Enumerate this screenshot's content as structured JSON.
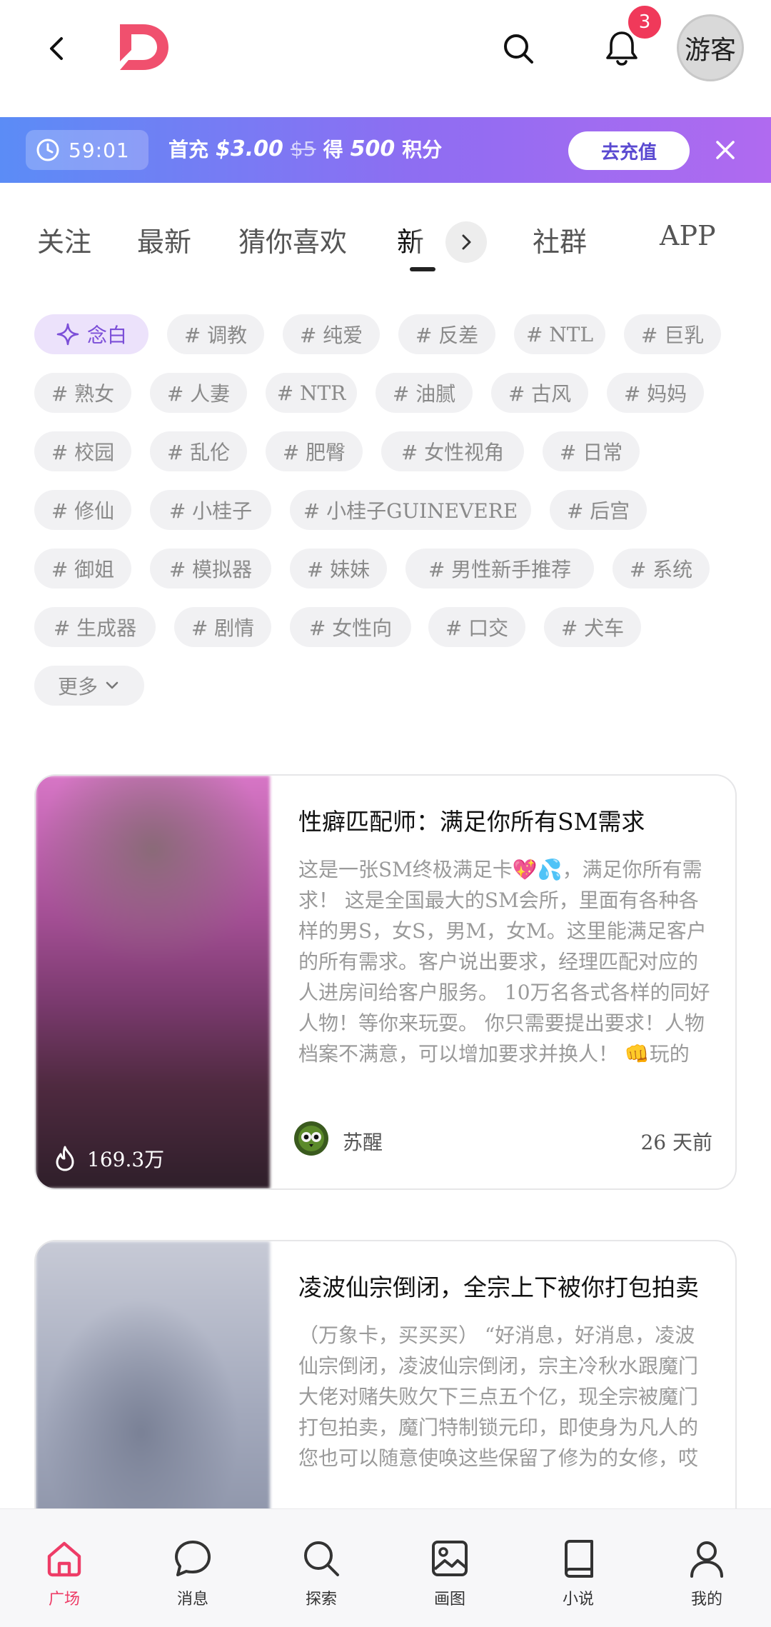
{
  "header": {
    "avatar_label": "游客",
    "notification_count": "3"
  },
  "promo": {
    "timer": "59:01",
    "text_prefix": "首充",
    "price": "$3.00",
    "original_price": "$5",
    "text_get": "得",
    "points": "500",
    "text_suffix": "积分",
    "cta": "去充值"
  },
  "tabs": [
    "关注",
    "最新",
    "猜你喜欢",
    "新",
    "社群",
    "APP"
  ],
  "tags": {
    "featured": "念白",
    "items": [
      "# 调教",
      "# 纯爱",
      "# 反差",
      "# NTL",
      "# 巨乳",
      "# 熟女",
      "# 人妻",
      "# NTR",
      "# 油腻",
      "# 古风",
      "# 妈妈",
      "# 校园",
      "# 乱伦",
      "# 肥臀",
      "# 女性视角",
      "# 日常",
      "# 修仙",
      "# 小桂子",
      "# 小桂子GUINEVERE",
      "# 后宫",
      "# 御姐",
      "# 模拟器",
      "# 妹妹",
      "# 男性新手推荐",
      "# 系统",
      "# 生成器",
      "# 剧情",
      "# 女性向",
      "# 口交",
      "# 犬车"
    ],
    "more": "更多"
  },
  "cards": [
    {
      "title": "性癖匹配师：满足你所有SM需求",
      "description": "这是一张SM终极满足卡💖💦，满足你所有需求！ 这是全国最大的SM会所，里面有各种各样的男S，女S，男M，女M。这里能满足客户的所有需求。客户说出要求，经理匹配对应的人进房间给客户服务。 10万名各式各样的同好人物！等你来玩耍。 你只需要提出要求！人物档案不满意，可以增加要求并换人！ 👊玩的",
      "views": "169.3万",
      "author": "苏醒",
      "time": "26 天前"
    },
    {
      "title": "凌波仙宗倒闭，全宗上下被你打包拍卖",
      "description": "（万象卡，买买买） “好消息，好消息，凌波仙宗倒闭，凌波仙宗倒闭，宗主冷秋水跟魔门大佬对赌失败欠下三点五个亿，现全宗被魔门打包拍卖，魔门特制锁元印，即使身为凡人的您也可以随意使唤这些保留了修为的女修，哎"
    }
  ],
  "bottom_nav": [
    {
      "label": "广场",
      "icon": "home-icon",
      "active": true
    },
    {
      "label": "消息",
      "icon": "chat-icon",
      "active": false
    },
    {
      "label": "探索",
      "icon": "search-icon",
      "active": false
    },
    {
      "label": "画图",
      "icon": "image-icon",
      "active": false
    },
    {
      "label": "小说",
      "icon": "book-icon",
      "active": false
    },
    {
      "label": "我的",
      "icon": "user-icon",
      "active": false
    }
  ],
  "colors": {
    "brand": "#f0506e",
    "badge": "#f0395a",
    "active_nav": "#ee3c67",
    "featured_tag": "#7c4fd8",
    "promo_start": "#5b8cf6",
    "promo_end": "#b06af0"
  }
}
